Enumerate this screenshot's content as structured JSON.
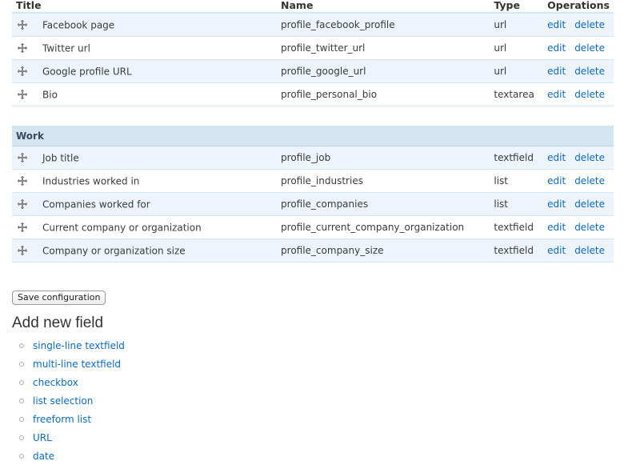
{
  "table": {
    "headers": {
      "title": "Title",
      "name": "Name",
      "type": "Type",
      "operations": "Operations"
    },
    "groups": [
      {
        "region": "",
        "rows": [
          {
            "title": "Facebook page",
            "name": "profile_facebook_profile",
            "type": "url",
            "edit": "edit",
            "delete": "delete"
          },
          {
            "title": "Twitter url",
            "name": "profile_twitter_url",
            "type": "url",
            "edit": "edit",
            "delete": "delete"
          },
          {
            "title": "Google profile URL",
            "name": "profile_google_url",
            "type": "url",
            "edit": "edit",
            "delete": "delete"
          },
          {
            "title": "Bio",
            "name": "profile_personal_bio",
            "type": "textarea",
            "edit": "edit",
            "delete": "delete"
          }
        ]
      },
      {
        "region": "Work",
        "rows": [
          {
            "title": "Job title",
            "name": "profile_job",
            "type": "textfield",
            "edit": "edit",
            "delete": "delete"
          },
          {
            "title": "Industries worked in",
            "name": "profile_industries",
            "type": "list",
            "edit": "edit",
            "delete": "delete"
          },
          {
            "title": "Companies worked for",
            "name": "profile_companies",
            "type": "list",
            "edit": "edit",
            "delete": "delete"
          },
          {
            "title": "Current company or organization",
            "name": "profile_current_company_organization",
            "type": "textfield",
            "edit": "edit",
            "delete": "delete"
          },
          {
            "title": "Company or organization size",
            "name": "profile_company_size",
            "type": "textfield",
            "edit": "edit",
            "delete": "delete"
          }
        ]
      }
    ]
  },
  "save_button": "Save configuration",
  "add_new_field": {
    "heading": "Add new field",
    "items": [
      "single-line textfield",
      "multi-line textfield",
      "checkbox",
      "list selection",
      "freeform list",
      "URL",
      "date"
    ]
  },
  "icons": {
    "drag": "drag-handle-icon (cross arrows)",
    "bullet": "circle-bullet-icon"
  },
  "colors": {
    "link": "#0b6bc3",
    "row_odd": "#edf4fb",
    "region_bg": "#d4e5f2",
    "border": "#d3e7f4"
  }
}
